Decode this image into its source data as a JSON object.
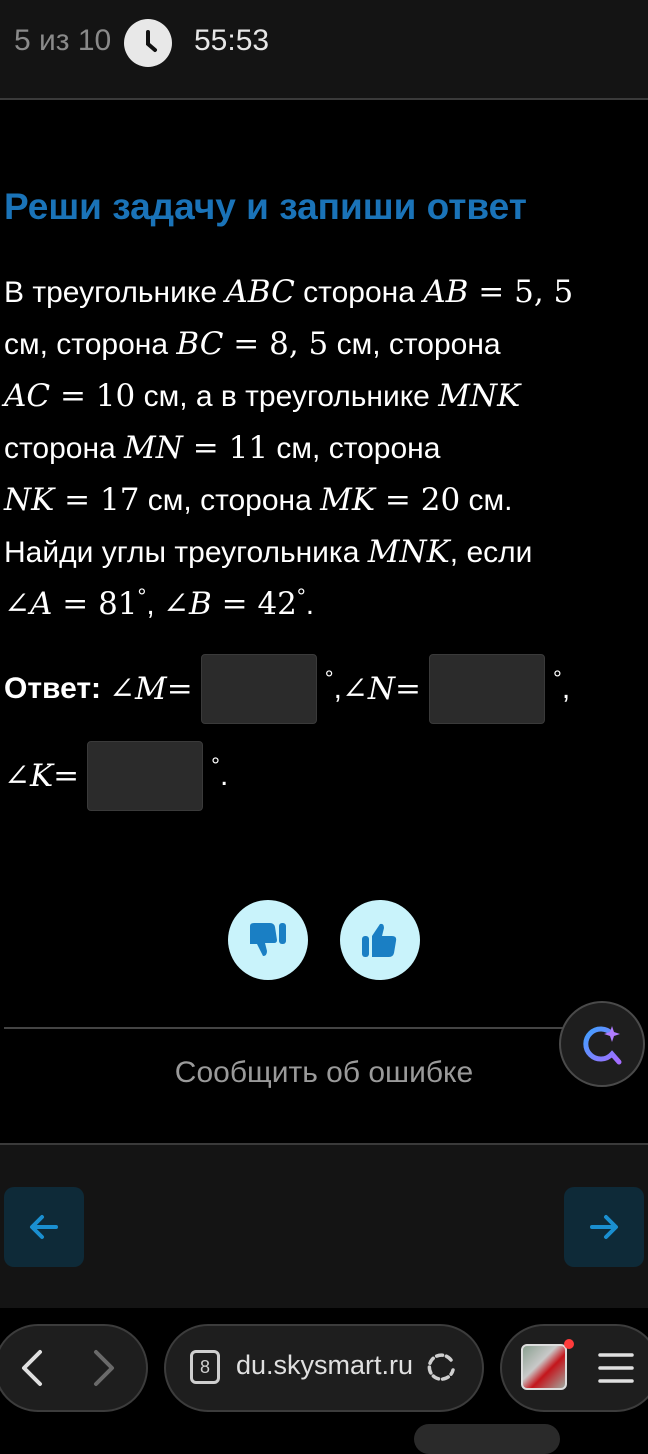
{
  "header": {
    "progress": "5 из 10",
    "timer": "55:53"
  },
  "task": {
    "title": "Реши задачу и запиши ответ",
    "line1": {
      "t1": "В треугольнике ",
      "m1": "ABC",
      "t2": " сторона ",
      "m2": "AB",
      "eq": " = ",
      "n1": "5, 5"
    },
    "line2": {
      "t1": "см, сторона ",
      "m1": "BC",
      "eq": " = ",
      "n1": "8, 5",
      "t2": " см, сторона"
    },
    "line3": {
      "m1": "AC",
      "eq": " = ",
      "n1": "10",
      "t1": " см, а в треугольнике ",
      "m2": "MNK"
    },
    "line4": {
      "t1": "сторона ",
      "m1": "MN",
      "eq": " = ",
      "n1": "11",
      "t2": " см, сторона"
    },
    "line5": {
      "m1": "NK",
      "eq": " = ",
      "n1": "17",
      "t1": " см, сторона ",
      "m2": "MK",
      "eq2": " = ",
      "n2": "20",
      "t2": " см."
    },
    "line6": {
      "t1": "Найди углы треугольника ",
      "m1": "MNK",
      "t2": ", если"
    },
    "line7": {
      "a1": "∠A",
      "eq": " = ",
      "n1": "81",
      "sep": ", ",
      "a2": "∠B",
      "eq2": " = ",
      "n2": "42",
      "end": "."
    }
  },
  "answer": {
    "label": "Ответ:",
    "angle_m": "∠M",
    "angle_n": "∠N",
    "angle_k": "∠K",
    "eq": " = ",
    "degree": "°",
    "comma": ",",
    "period": ".",
    "field_m": "",
    "field_n": "",
    "field_k": ""
  },
  "feedback": {
    "dislike_icon": "thumbs-down-icon",
    "like_icon": "thumbs-up-icon",
    "report_label": "Сообщить об ошибке"
  },
  "nav": {
    "prev_icon": "arrow-left-icon",
    "next_icon": "arrow-right-icon"
  },
  "browser": {
    "url": "du.skysmart.ru",
    "tab_count": "8"
  },
  "colors": {
    "title": "#1a73b8",
    "vote_bg": "#c9f3fb",
    "nav_btn_bg": "#0e2a38",
    "accent": "#1a8fd0"
  }
}
